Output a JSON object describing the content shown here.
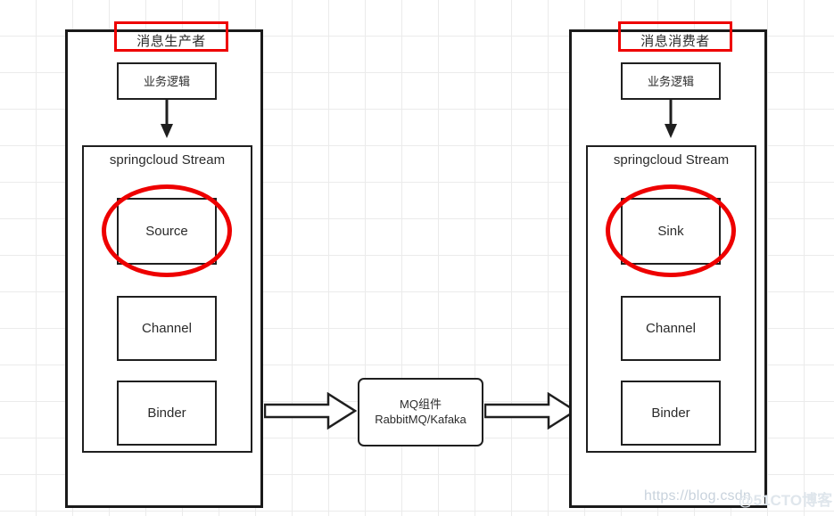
{
  "diagram": {
    "title_producer": "消息生产者",
    "title_consumer": "消息消费者",
    "business_logic_label": "业务逻辑",
    "stream_label": "springcloud Stream",
    "producer_boxes": [
      "Source",
      "Channel",
      "Binder"
    ],
    "consumer_boxes": [
      "Sink",
      "Channel",
      "Binder"
    ],
    "mq": {
      "line1": "MQ组件",
      "line2": "RabbitMQ/Kafaka"
    },
    "highlight_color": "#ee0000",
    "line_color": "#1f1f1f",
    "grid_color": "#ebebeb",
    "watermark": "https://blog.csdn",
    "watermark_overlay": "@51CTO博客"
  }
}
